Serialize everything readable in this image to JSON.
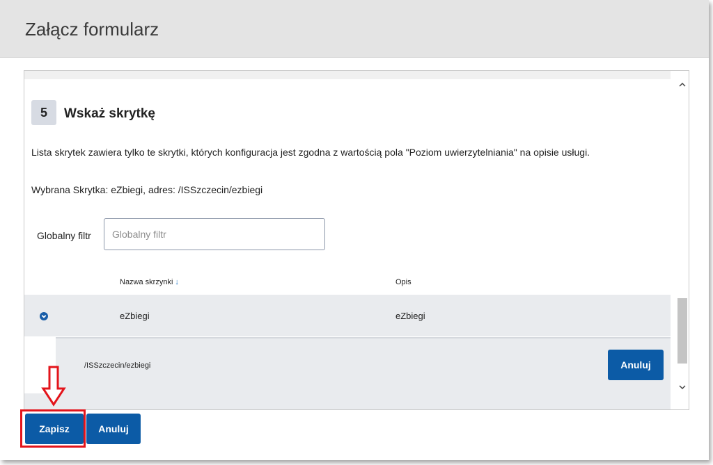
{
  "dialog": {
    "title": "Załącz formularz"
  },
  "step": {
    "number": "5",
    "title": "Wskaż skrytkę",
    "description": "Lista skrytek zawiera tylko te skrytki, których konfiguracja jest zgodna z wartością pola \"Poziom uwierzytelniania\" na opisie usługi.",
    "selected": "Wybrana Skrytka: eZbiegi, adres: /ISSzczecin/ezbiegi"
  },
  "filter": {
    "label": "Globalny filtr",
    "placeholder": "Globalny filtr",
    "value": ""
  },
  "table": {
    "columns": [
      "Nazwa skrzynki",
      "Opis"
    ],
    "sort_icon": "arrow-down-icon",
    "rows": [
      {
        "name": "eZbiegi",
        "description": "eZbiegi",
        "expanded": true,
        "detail": "/ISSzczecin/ezbiegi",
        "detail_button": "Anuluj"
      }
    ]
  },
  "footer": {
    "save_label": "Zapisz",
    "cancel_label": "Anuluj"
  },
  "colors": {
    "primary": "#0c5ba6",
    "highlight": "#e3141b",
    "header_bg": "#e4e4e4",
    "row_bg": "#e9ebee"
  }
}
